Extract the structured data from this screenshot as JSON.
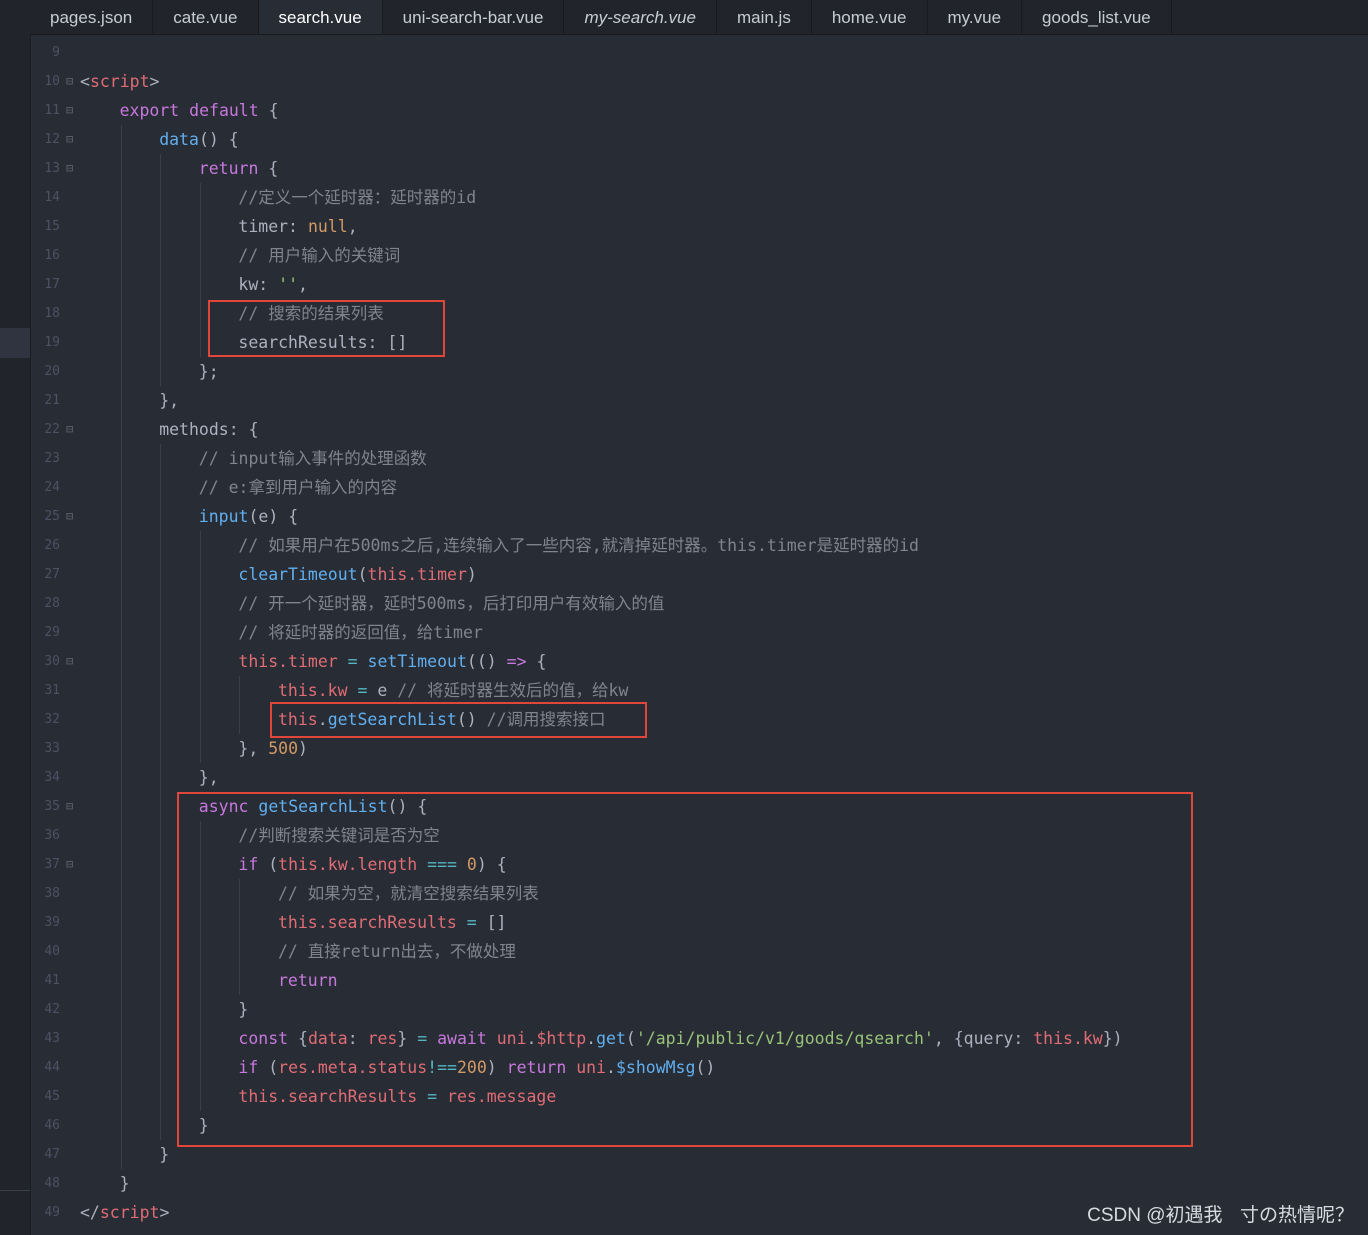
{
  "tabs": [
    {
      "label": "pages.json"
    },
    {
      "label": "cate.vue"
    },
    {
      "label": "search.vue",
      "active": true
    },
    {
      "label": "uni-search-bar.vue"
    },
    {
      "label": "my-search.vue",
      "italic": true
    },
    {
      "label": "main.js"
    },
    {
      "label": "home.vue"
    },
    {
      "label": "my.vue"
    },
    {
      "label": "goods_list.vue"
    }
  ],
  "lines": [
    {
      "n": "9",
      "indent": 0,
      "fold": false,
      "tokens": []
    },
    {
      "n": "10",
      "indent": 0,
      "fold": true,
      "tokens": [
        [
          "",
          "<"
        ],
        [
          "th",
          "script"
        ],
        [
          "",
          ">"
        ]
      ]
    },
    {
      "n": "11",
      "indent": 1,
      "fold": true,
      "tokens": [
        [
          "kw",
          "export"
        ],
        [
          "",
          " "
        ],
        [
          "kw",
          "default"
        ],
        [
          "",
          " {"
        ]
      ]
    },
    {
      "n": "12",
      "indent": 2,
      "fold": true,
      "tokens": [
        [
          "fn",
          "data"
        ],
        [
          "",
          "() {"
        ]
      ]
    },
    {
      "n": "13",
      "indent": 3,
      "fold": true,
      "tokens": [
        [
          "kw",
          "return"
        ],
        [
          "",
          " {"
        ]
      ]
    },
    {
      "n": "14",
      "indent": 4,
      "fold": false,
      "tokens": [
        [
          "cm",
          "//定义一个延时器：延时器的id"
        ]
      ]
    },
    {
      "n": "15",
      "indent": 4,
      "fold": false,
      "tokens": [
        [
          "",
          "timer: "
        ],
        [
          "num",
          "null"
        ],
        [
          "",
          ","
        ]
      ]
    },
    {
      "n": "16",
      "indent": 4,
      "fold": false,
      "tokens": [
        [
          "cm",
          "// 用户输入的关键词"
        ]
      ]
    },
    {
      "n": "17",
      "indent": 4,
      "fold": false,
      "tokens": [
        [
          "",
          "kw: "
        ],
        [
          "str",
          "''"
        ],
        [
          "",
          ","
        ]
      ]
    },
    {
      "n": "18",
      "indent": 4,
      "fold": false,
      "tokens": [
        [
          "cm",
          "// 搜索的结果列表"
        ]
      ]
    },
    {
      "n": "19",
      "indent": 4,
      "fold": false,
      "tokens": [
        [
          "",
          "searchResults: []"
        ]
      ]
    },
    {
      "n": "20",
      "indent": 3,
      "fold": false,
      "tokens": [
        [
          "",
          "};"
        ]
      ]
    },
    {
      "n": "21",
      "indent": 2,
      "fold": false,
      "tokens": [
        [
          "",
          "},"
        ]
      ]
    },
    {
      "n": "22",
      "indent": 2,
      "fold": true,
      "tokens": [
        [
          "",
          "methods: {"
        ]
      ]
    },
    {
      "n": "23",
      "indent": 3,
      "fold": false,
      "tokens": [
        [
          "cm",
          "// input输入事件的处理函数"
        ]
      ]
    },
    {
      "n": "24",
      "indent": 3,
      "fold": false,
      "tokens": [
        [
          "cm",
          "// e:拿到用户输入的内容"
        ]
      ]
    },
    {
      "n": "25",
      "indent": 3,
      "fold": true,
      "tokens": [
        [
          "fn",
          "input"
        ],
        [
          "",
          "(e) {"
        ]
      ]
    },
    {
      "n": "26",
      "indent": 4,
      "fold": false,
      "tokens": [
        [
          "cm",
          "// 如果用户在500ms之后,连续输入了一些内容,就清掉延时器。this.timer是延时器的id"
        ]
      ]
    },
    {
      "n": "27",
      "indent": 4,
      "fold": false,
      "tokens": [
        [
          "fn",
          "clearTimeout"
        ],
        [
          "",
          "("
        ],
        [
          "th",
          "this.timer"
        ],
        [
          "",
          ")"
        ]
      ]
    },
    {
      "n": "28",
      "indent": 4,
      "fold": false,
      "tokens": [
        [
          "cm",
          "// 开一个延时器，延时500ms，后打印用户有效输入的值"
        ]
      ]
    },
    {
      "n": "29",
      "indent": 4,
      "fold": false,
      "tokens": [
        [
          "cm",
          "// 将延时器的返回值，给timer"
        ]
      ]
    },
    {
      "n": "30",
      "indent": 4,
      "fold": true,
      "tokens": [
        [
          "th",
          "this.timer"
        ],
        [
          "",
          " "
        ],
        [
          "op",
          "="
        ],
        [
          "",
          " "
        ],
        [
          "fn",
          "setTimeout"
        ],
        [
          "",
          "(() "
        ],
        [
          "kw",
          "=>"
        ],
        [
          "",
          " {"
        ]
      ]
    },
    {
      "n": "31",
      "indent": 5,
      "fold": false,
      "tokens": [
        [
          "th",
          "this.kw"
        ],
        [
          "",
          " "
        ],
        [
          "op",
          "="
        ],
        [
          "",
          " e "
        ],
        [
          "cm",
          "// 将延时器生效后的值，给kw"
        ]
      ]
    },
    {
      "n": "32",
      "indent": 5,
      "fold": false,
      "tokens": [
        [
          "th",
          "this"
        ],
        [
          "",
          "."
        ],
        [
          "fn",
          "getSearchList"
        ],
        [
          "",
          "() "
        ],
        [
          "cm",
          "//调用搜索接口"
        ]
      ]
    },
    {
      "n": "33",
      "indent": 4,
      "fold": false,
      "tokens": [
        [
          "",
          "}, "
        ],
        [
          "num",
          "500"
        ],
        [
          "",
          ")"
        ]
      ]
    },
    {
      "n": "34",
      "indent": 3,
      "fold": false,
      "tokens": [
        [
          "",
          "},"
        ]
      ]
    },
    {
      "n": "35",
      "indent": 3,
      "fold": true,
      "tokens": [
        [
          "kw",
          "async"
        ],
        [
          "",
          " "
        ],
        [
          "fn",
          "getSearchList"
        ],
        [
          "",
          "() {"
        ]
      ]
    },
    {
      "n": "36",
      "indent": 4,
      "fold": false,
      "tokens": [
        [
          "cm",
          "//判断搜索关键词是否为空"
        ]
      ]
    },
    {
      "n": "37",
      "indent": 4,
      "fold": true,
      "tokens": [
        [
          "kw",
          "if"
        ],
        [
          "",
          " ("
        ],
        [
          "th",
          "this.kw.length"
        ],
        [
          "",
          " "
        ],
        [
          "op",
          "==="
        ],
        [
          "",
          " "
        ],
        [
          "num",
          "0"
        ],
        [
          "",
          ") {"
        ]
      ]
    },
    {
      "n": "38",
      "indent": 5,
      "fold": false,
      "tokens": [
        [
          "cm",
          "// 如果为空，就清空搜索结果列表"
        ]
      ]
    },
    {
      "n": "39",
      "indent": 5,
      "fold": false,
      "tokens": [
        [
          "th",
          "this.searchResults"
        ],
        [
          "",
          " "
        ],
        [
          "op",
          "="
        ],
        [
          "",
          " []"
        ]
      ]
    },
    {
      "n": "40",
      "indent": 5,
      "fold": false,
      "tokens": [
        [
          "cm",
          "// 直接return出去，不做处理"
        ]
      ]
    },
    {
      "n": "41",
      "indent": 5,
      "fold": false,
      "tokens": [
        [
          "kw",
          "return"
        ]
      ]
    },
    {
      "n": "42",
      "indent": 4,
      "fold": false,
      "tokens": [
        [
          "",
          "}"
        ]
      ]
    },
    {
      "n": "43",
      "indent": 4,
      "fold": false,
      "tokens": [
        [
          "kw",
          "const"
        ],
        [
          "",
          " {"
        ],
        [
          "th",
          "data"
        ],
        [
          "",
          ": "
        ],
        [
          "th",
          "res"
        ],
        [
          "",
          "} "
        ],
        [
          "op",
          "="
        ],
        [
          "",
          " "
        ],
        [
          "kw",
          "await"
        ],
        [
          "",
          " "
        ],
        [
          "th",
          "uni"
        ],
        [
          "",
          "."
        ],
        [
          "th",
          "$http"
        ],
        [
          "",
          "."
        ],
        [
          "fn",
          "get"
        ],
        [
          "",
          "("
        ],
        [
          "str",
          "'/api/public/v1/goods/qsearch'"
        ],
        [
          "",
          ", {query: "
        ],
        [
          "th",
          "this.kw"
        ],
        [
          "",
          "})"
        ]
      ]
    },
    {
      "n": "44",
      "indent": 4,
      "fold": false,
      "tokens": [
        [
          "kw",
          "if"
        ],
        [
          "",
          " ("
        ],
        [
          "th",
          "res.meta.status"
        ],
        [
          "op",
          "!=="
        ],
        [
          "num",
          "200"
        ],
        [
          "",
          ") "
        ],
        [
          "kw",
          "return"
        ],
        [
          "",
          " "
        ],
        [
          "th",
          "uni"
        ],
        [
          "",
          "."
        ],
        [
          "fn",
          "$showMsg"
        ],
        [
          "",
          "()"
        ]
      ]
    },
    {
      "n": "45",
      "indent": 4,
      "fold": false,
      "tokens": [
        [
          "th",
          "this.searchResults"
        ],
        [
          "",
          " "
        ],
        [
          "op",
          "="
        ],
        [
          "",
          " "
        ],
        [
          "th",
          "res.message"
        ]
      ]
    },
    {
      "n": "46",
      "indent": 3,
      "fold": false,
      "tokens": [
        [
          "",
          "}"
        ]
      ]
    },
    {
      "n": "47",
      "indent": 2,
      "fold": false,
      "tokens": [
        [
          "",
          "}"
        ]
      ]
    },
    {
      "n": "48",
      "indent": 1,
      "fold": false,
      "tokens": [
        [
          "",
          "}"
        ]
      ]
    },
    {
      "n": "49",
      "indent": 0,
      "fold": false,
      "tokens": [
        [
          "",
          "</"
        ],
        [
          "th",
          "script"
        ],
        [
          "",
          ">"
        ]
      ]
    }
  ],
  "watermark": "CSDN @初遇我ㅤ寸の热情呢？",
  "colors": {
    "background": "#282c34",
    "highlight_box": "#e0463a"
  }
}
